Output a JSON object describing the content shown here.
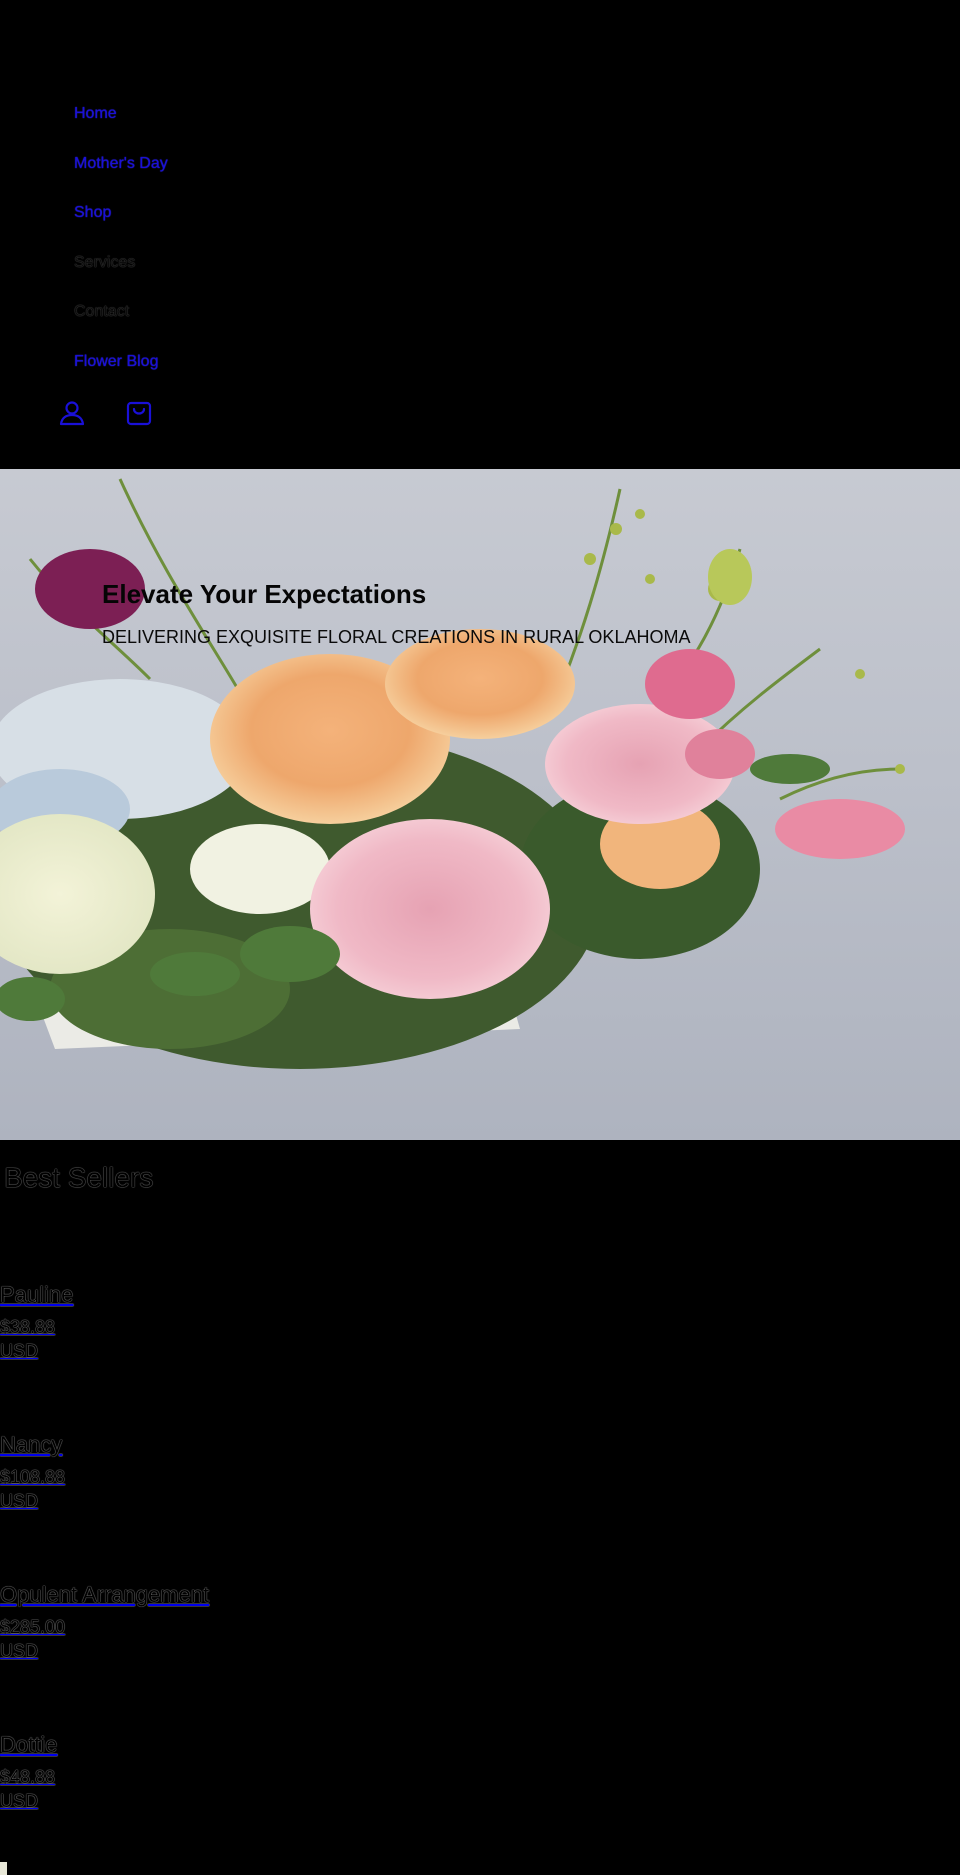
{
  "nav": {
    "links": [
      {
        "label": "Home",
        "style": "link"
      },
      {
        "label": "Mother's Day",
        "style": "link"
      },
      {
        "label": "Shop",
        "style": "link"
      },
      {
        "label": "Services",
        "style": "muted"
      },
      {
        "label": "Contact",
        "style": "muted"
      },
      {
        "label": "Flower Blog",
        "style": "link"
      }
    ],
    "icons": {
      "account": "account-icon",
      "cart": "cart-icon"
    },
    "colors": {
      "link": "#1a10d8",
      "icon": "#1a10d8"
    }
  },
  "hero": {
    "title": "Elevate Your Expectations",
    "subtitle": "DELIVERING EXQUISITE FLORAL CREATIONS IN RURAL OKLAHOMA"
  },
  "best_sellers": {
    "title": "Best Sellers",
    "products": [
      {
        "name": "Pauline",
        "price": "$38.88",
        "currency": "USD"
      },
      {
        "name": "Nancy",
        "price": "$108.88",
        "currency": "USD"
      },
      {
        "name": "Opulent Arrangement",
        "price": "$285.00",
        "currency": "USD"
      },
      {
        "name": "Dottie",
        "price": "$48.88",
        "currency": "USD"
      }
    ]
  }
}
